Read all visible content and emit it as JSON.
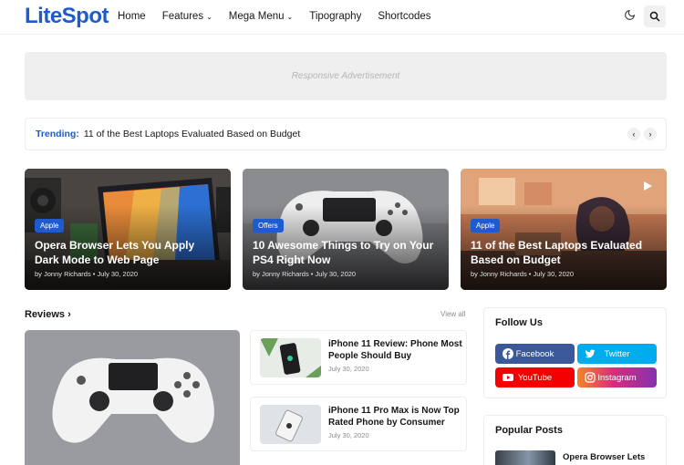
{
  "header": {
    "logo_part1": "Lite",
    "logo_part2": "Spot",
    "nav": [
      {
        "label": "Home",
        "has_dropdown": false
      },
      {
        "label": "Features",
        "has_dropdown": true
      },
      {
        "label": "Mega Menu",
        "has_dropdown": true
      },
      {
        "label": "Tipography",
        "has_dropdown": false
      },
      {
        "label": "Shortcodes",
        "has_dropdown": false
      }
    ],
    "dark_mode_icon": "moon-icon",
    "search_icon": "search-icon"
  },
  "ad": {
    "text": "Responsive Advertisement"
  },
  "trending": {
    "label": "Trending:",
    "text": "11 of the Best Laptops Evaluated Based on Budget",
    "prev": "‹",
    "next": "›"
  },
  "featured": [
    {
      "tag": "Apple",
      "title": "Opera Browser Lets You Apply Dark Mode to Web Page",
      "meta": "by Jonny Richards • July 30, 2020"
    },
    {
      "tag": "Offers",
      "title": "10 Awesome Things to Try on Your PS4 Right Now",
      "meta": "by Jonny Richards • July 30, 2020"
    },
    {
      "tag": "Apple",
      "title": "11 of the Best Laptops Evaluated Based on Budget",
      "meta": "by Jonny Richards • July 30, 2020"
    }
  ],
  "reviews": {
    "title": "Reviews",
    "chevron": "›",
    "view_all": "View all",
    "items": [
      {
        "title": "iPhone 11 Review: Phone Most People Should Buy",
        "date": "July 30, 2020"
      },
      {
        "title": "iPhone 11 Pro Max is Now Top Rated Phone by Consumer",
        "date": "July 30, 2020"
      }
    ]
  },
  "follow_us": {
    "title": "Follow Us",
    "buttons": [
      {
        "label": "Facebook",
        "color": "#3b5999"
      },
      {
        "label": "Twitter",
        "color": "#00acee"
      },
      {
        "label": "YouTube",
        "color": "#f50000"
      },
      {
        "label": "Instagram",
        "color": "#c13584"
      }
    ]
  },
  "popular_posts": {
    "title": "Popular Posts",
    "first_title": "Opera Browser Lets"
  },
  "colors": {
    "accent": "#1e5bcf"
  }
}
